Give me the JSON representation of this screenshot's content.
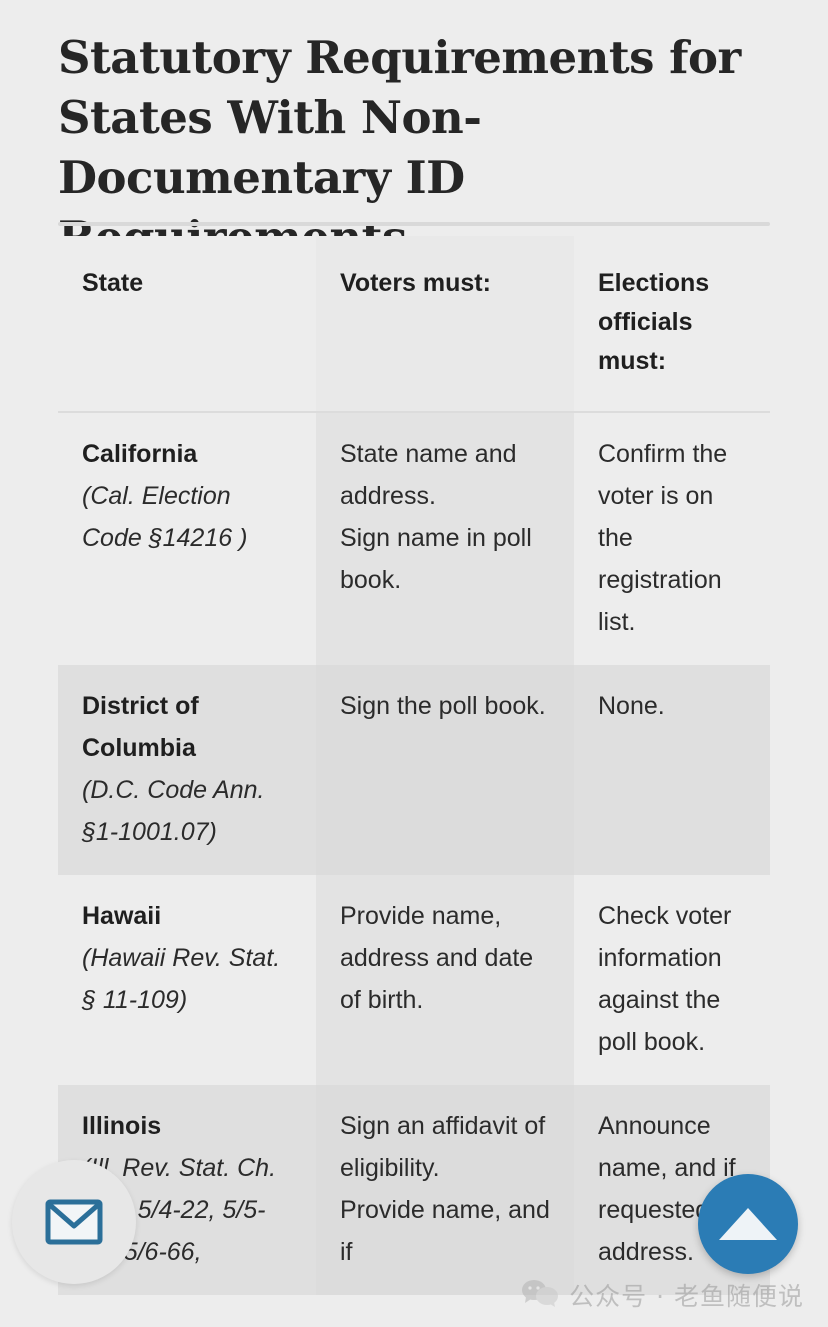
{
  "title": "Statutory Requirements for States With Non-Documentary ID Requirements",
  "table": {
    "headers": {
      "state": "State",
      "voters": "Voters must:",
      "officials": "Elections officials must:"
    },
    "rows": [
      {
        "state_name": "California",
        "state_cite": "(Cal. Election Code §14216 )",
        "voters": "State name and address.\nSign name in poll book.",
        "officials": "Confirm the voter is on the registration list."
      },
      {
        "state_name": "District of Columbia",
        "state_cite": "(D.C. Code Ann. §1-1001.07)",
        "voters": "Sign the poll book.",
        "officials": "None."
      },
      {
        "state_name": "Hawaii",
        "state_cite": "(Hawaii Rev. Stat. § 11-109)",
        "voters": "Provide name, address and date of birth.",
        "officials": "Check voter information against the poll book."
      },
      {
        "state_name": "Illinois",
        "state_cite": "(Ill. Rev. Stat. Ch. 10 § 5/4-22, 5/5-29, 5/6-66,",
        "voters": "Sign an affidavit of eligibility.\nProvide name, and if",
        "officials": "Announce name, and if requested, address."
      }
    ]
  },
  "floating": {
    "mail_icon": "envelope-icon",
    "scroll_top_icon": "triangle-up-icon"
  },
  "watermark": {
    "icon": "wechat-icon",
    "text": "公众号 · 老鱼随便说"
  },
  "colors": {
    "page_bg": "#ededed",
    "stripe_bg": "#dfdfdf",
    "column_tint": "#e3e3e3",
    "accent_blue": "#2b7cb5",
    "text": "#2b2b2b"
  }
}
